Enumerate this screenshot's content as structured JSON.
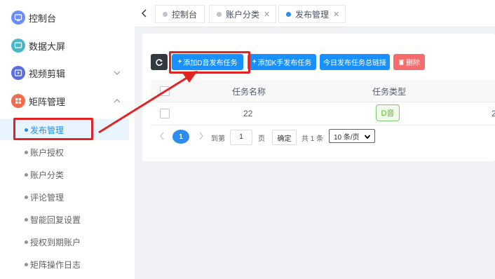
{
  "sidebar": {
    "items": [
      {
        "label": "控制台",
        "icon": "dashboard-icon",
        "color": "#6b8cff"
      },
      {
        "label": "数据大屏",
        "icon": "monitor-icon",
        "color": "#4ab8c8"
      },
      {
        "label": "视频剪辑",
        "icon": "video-icon",
        "color": "#5b6ee1"
      },
      {
        "label": "矩阵管理",
        "icon": "matrix-icon",
        "color": "#f26b4f"
      }
    ],
    "submenu": [
      "发布管理",
      "账户授权",
      "账户分类",
      "评论管理",
      "智能回复设置",
      "授权到期账户",
      "矩阵操作日志"
    ],
    "active_submenu": "发布管理"
  },
  "tabs": [
    {
      "label": "控制台",
      "closable": false
    },
    {
      "label": "账户分类",
      "closable": true
    },
    {
      "label": "发布管理",
      "closable": true,
      "active": true
    }
  ],
  "toolbar": {
    "refresh_icon": "refresh-icon",
    "add_douyin": "添加D音发布任务",
    "add_kuaishou": "添加K手发布任务",
    "today_summary": "今日发布任务总链接",
    "delete": "删除"
  },
  "table": {
    "columns": [
      "任务名称",
      "任务类型"
    ],
    "rows": [
      {
        "name": "22",
        "type": "D音",
        "extra": "2"
      }
    ]
  },
  "pagination": {
    "current_page": "1",
    "goto_label": "到第",
    "goto_value": "1",
    "page_unit": "页",
    "confirm": "确定",
    "total": "共 1 条",
    "page_size": "10 条/页"
  },
  "colors": {
    "primary": "#1890ff",
    "danger": "#f56c6c",
    "annotation": "#e02424"
  }
}
